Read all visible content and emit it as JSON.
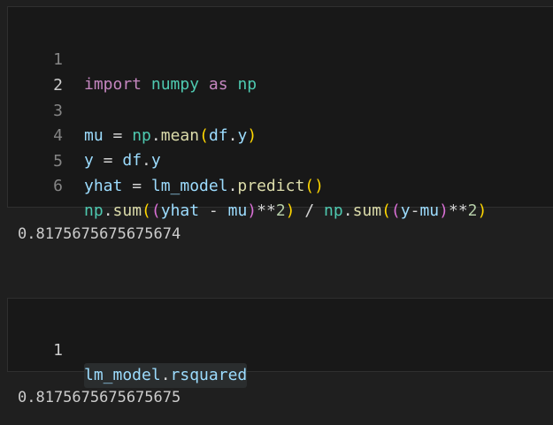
{
  "cell1": {
    "line_numbers": [
      "1",
      "2",
      "3",
      "4",
      "5",
      "6"
    ],
    "lines": [
      {
        "tokens": [
          "import",
          " ",
          "numpy",
          " ",
          "as",
          " ",
          "np"
        ]
      },
      {
        "tokens": []
      },
      {
        "tokens": [
          "mu",
          " = ",
          "np",
          ".",
          "mean",
          "(",
          "df",
          ".",
          "y",
          ")"
        ]
      },
      {
        "tokens": [
          "y",
          " = ",
          "df",
          ".",
          "y"
        ]
      },
      {
        "tokens": [
          "yhat",
          " = ",
          "lm_model",
          ".",
          "predict",
          "()"
        ]
      },
      {
        "tokens": [
          "np",
          ".",
          "sum",
          "(",
          "(",
          "yhat",
          " - ",
          "mu",
          ")",
          "**",
          "2",
          ")",
          " / ",
          "np",
          ".",
          "sum",
          "(",
          "(",
          "y",
          "-",
          "mu",
          ")",
          "**",
          "2",
          ")"
        ]
      }
    ]
  },
  "output1": "0.8175675675675674",
  "cell2": {
    "line_numbers": [
      "1"
    ],
    "lines": [
      {
        "tokens": [
          "lm_model",
          ".",
          "rsquared"
        ]
      }
    ]
  },
  "output2": "0.8175675675675675",
  "colors": {
    "background": "#1f1f1f",
    "cell_background": "#181818",
    "keyword": "#c586c0",
    "module": "#4ec9b0",
    "variable": "#9cdcfe",
    "function": "#dcdcaa",
    "number": "#b5cea8",
    "bracket_level_1": "#ffd700",
    "bracket_level_2": "#da70d6",
    "bracket_level_3": "#179fff"
  }
}
